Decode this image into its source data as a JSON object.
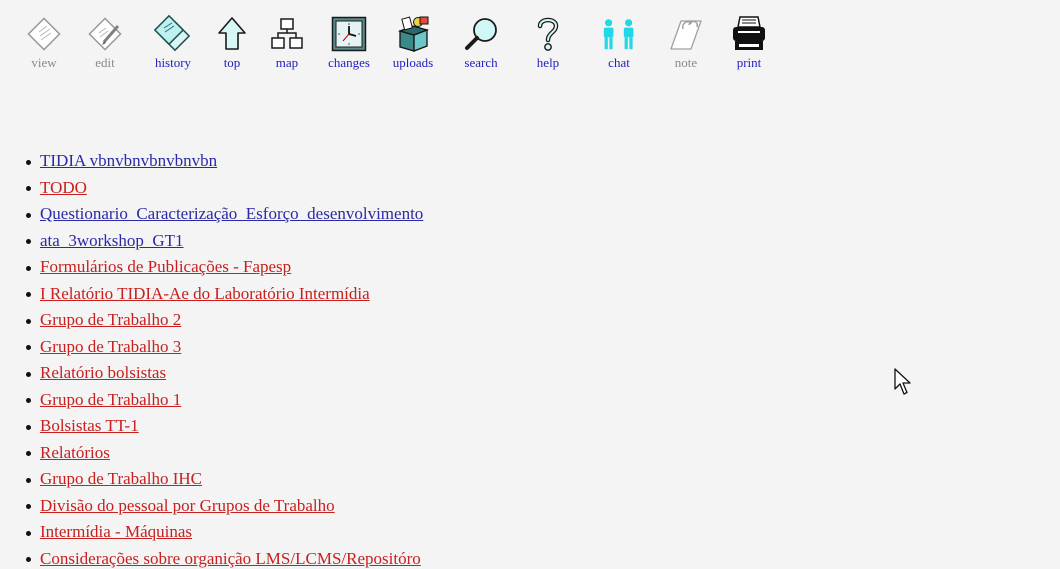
{
  "toolbar": {
    "items": [
      {
        "label": "view",
        "icon": "view-icon",
        "enabled": false
      },
      {
        "label": "edit",
        "icon": "edit-icon",
        "enabled": false
      },
      {
        "label": "history",
        "icon": "history-icon",
        "enabled": true
      },
      {
        "label": "top",
        "icon": "up-arrow-icon",
        "enabled": true
      },
      {
        "label": "map",
        "icon": "sitemap-icon",
        "enabled": true
      },
      {
        "label": "changes",
        "icon": "clock-icon",
        "enabled": true
      },
      {
        "label": "uploads",
        "icon": "box-icon",
        "enabled": true
      },
      {
        "label": "search",
        "icon": "magnifier-icon",
        "enabled": true
      },
      {
        "label": "help",
        "icon": "question-icon",
        "enabled": true
      },
      {
        "label": "chat",
        "icon": "people-icon",
        "enabled": true
      },
      {
        "label": "note",
        "icon": "note-icon",
        "enabled": false
      },
      {
        "label": "print",
        "icon": "printer-icon",
        "enabled": true
      }
    ]
  },
  "pages": [
    {
      "title": "TIDIA vbnvbnvbnvbnvbn",
      "color": "blue"
    },
    {
      "title": "TODO",
      "color": "red"
    },
    {
      "title": "Questionario  Caracterização  Esforço  desenvolvimento",
      "color": "blue"
    },
    {
      "title": "ata  3workshop  GT1",
      "color": "blue"
    },
    {
      "title": "Formulários de Publicações - Fapesp",
      "color": "red"
    },
    {
      "title": "I Relatório TIDIA-Ae do Laboratório Intermídia",
      "color": "red"
    },
    {
      "title": "Grupo de Trabalho 2",
      "color": "red"
    },
    {
      "title": "Grupo de Trabalho 3",
      "color": "red"
    },
    {
      "title": "Relatório bolsistas",
      "color": "red"
    },
    {
      "title": "Grupo de Trabalho 1",
      "color": "red"
    },
    {
      "title": "Bolsistas TT-1",
      "color": "red"
    },
    {
      "title": "Relatórios",
      "color": "red"
    },
    {
      "title": "Grupo de Trabalho IHC",
      "color": "red"
    },
    {
      "title": "Divisão do pessoal por Grupos de Trabalho",
      "color": "red"
    },
    {
      "title": "Intermídia - Máquinas",
      "color": "red"
    },
    {
      "title": "Considerações sobre organição LMS/LCMS/Repositóro",
      "color": "red"
    }
  ],
  "colors": {
    "link_blue": "#2a2aa8",
    "link_red": "#c8201e",
    "label_active": "#1f1fbf",
    "label_disabled": "#8a8a8a"
  }
}
